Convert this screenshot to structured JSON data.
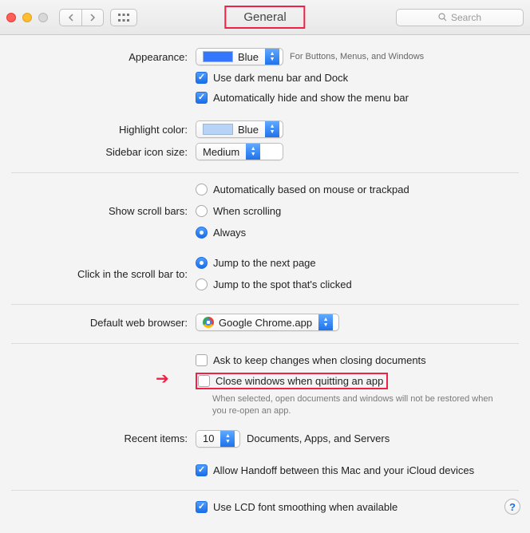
{
  "toolbar": {
    "title": "General",
    "search_placeholder": "Search"
  },
  "appearance": {
    "label": "Appearance:",
    "value": "Blue",
    "caption": "For Buttons, Menus, and Windows",
    "dark_menu": "Use dark menu bar and Dock",
    "auto_hide": "Automatically hide and show the menu bar"
  },
  "highlight": {
    "label": "Highlight color:",
    "value": "Blue"
  },
  "sidebar": {
    "label": "Sidebar icon size:",
    "value": "Medium"
  },
  "scrollbars": {
    "label": "Show scroll bars:",
    "opt1": "Automatically based on mouse or trackpad",
    "opt2": "When scrolling",
    "opt3": "Always"
  },
  "scrollclick": {
    "label": "Click in the scroll bar to:",
    "opt1": "Jump to the next page",
    "opt2": "Jump to the spot that's clicked"
  },
  "browser": {
    "label": "Default web browser:",
    "value": "Google Chrome.app"
  },
  "docs": {
    "ask_keep": "Ask to keep changes when closing documents",
    "close_windows": "Close windows when quitting an app",
    "close_help": "When selected, open documents and windows will not be restored when you re-open an app."
  },
  "recent": {
    "label": "Recent items:",
    "value": "10",
    "caption": "Documents, Apps, and Servers"
  },
  "handoff": "Allow Handoff between this Mac and your iCloud devices",
  "lcd": "Use LCD font smoothing when available",
  "help": "?"
}
